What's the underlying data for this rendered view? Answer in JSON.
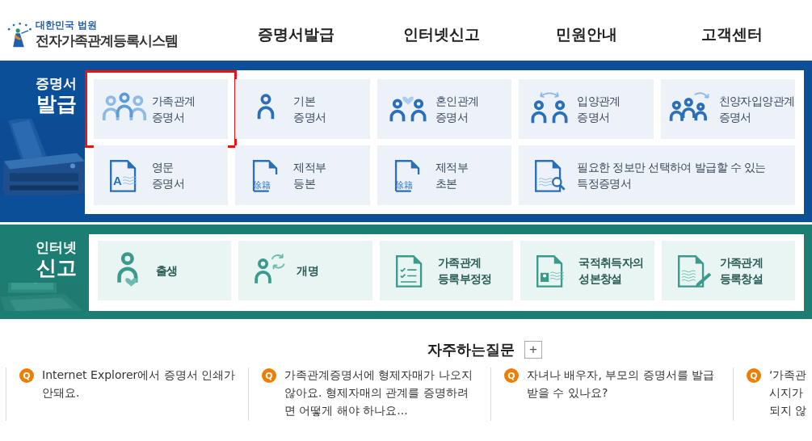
{
  "header": {
    "org": "대한민국 법원",
    "system": "전자가족관계등록시스템",
    "nav": [
      {
        "label": "증명서발급"
      },
      {
        "label": "인터넷신고"
      },
      {
        "label": "민원안내"
      },
      {
        "label": "고객센터"
      }
    ]
  },
  "certificates": {
    "label_top": "증명서",
    "label_bottom": "발급",
    "tiles": [
      {
        "kind": "family",
        "label": "가족관계\n증명서",
        "highlighted": true
      },
      {
        "kind": "person",
        "label": "기본\n증명서",
        "highlighted": false
      },
      {
        "kind": "marriage",
        "label": "혼인관계\n증명서",
        "highlighted": false
      },
      {
        "kind": "adoption",
        "label": "입양관계\n증명서",
        "highlighted": false
      },
      {
        "kind": "adoption-family",
        "label": "친양자입양관계\n증명서",
        "highlighted": false
      },
      {
        "kind": "english-doc",
        "icon_text": "A",
        "label": "영문\n증명서",
        "highlighted": false
      },
      {
        "kind": "jejeok-doc",
        "icon_text": "除籍",
        "label": "제적부\n등본",
        "highlighted": false
      },
      {
        "kind": "jejeok-doc",
        "icon_text": "除籍",
        "label": "제적부\n초본",
        "highlighted": false
      },
      {
        "kind": "search-doc",
        "label": "필요한 정보만 선택하여 발급할 수 있는\n특정증명서",
        "highlighted": false
      }
    ]
  },
  "reports": {
    "label_top": "인터넷",
    "label_bottom": "신고",
    "tiles": [
      {
        "kind": "birth",
        "label": "출생"
      },
      {
        "kind": "rename",
        "label": "개명"
      },
      {
        "kind": "checklist-doc",
        "label": "가족관계\n등록부정정"
      },
      {
        "kind": "id-doc",
        "label": "국적취득자의\n성본창설"
      },
      {
        "kind": "pen-doc",
        "label": "가족관계\n등록창설"
      }
    ]
  },
  "faq": {
    "title": "자주하는질문",
    "more": "+",
    "items": [
      {
        "badge": "Q",
        "text": "Internet Explorer에서 증명서 인쇄가\n안돼요."
      },
      {
        "badge": "Q",
        "text": "가족관계증명서에 형제자매가 나오지\n않아요. 형제자매의 관계를 증명하려\n면 어떻게 해야 하나요..."
      },
      {
        "badge": "Q",
        "text": "자녀나 배우자, 부모의 증명서를 발급\n받을 수 있나요?"
      },
      {
        "badge": "Q",
        "text": "‘가족관\n시지가\n되지 않"
      }
    ]
  }
}
